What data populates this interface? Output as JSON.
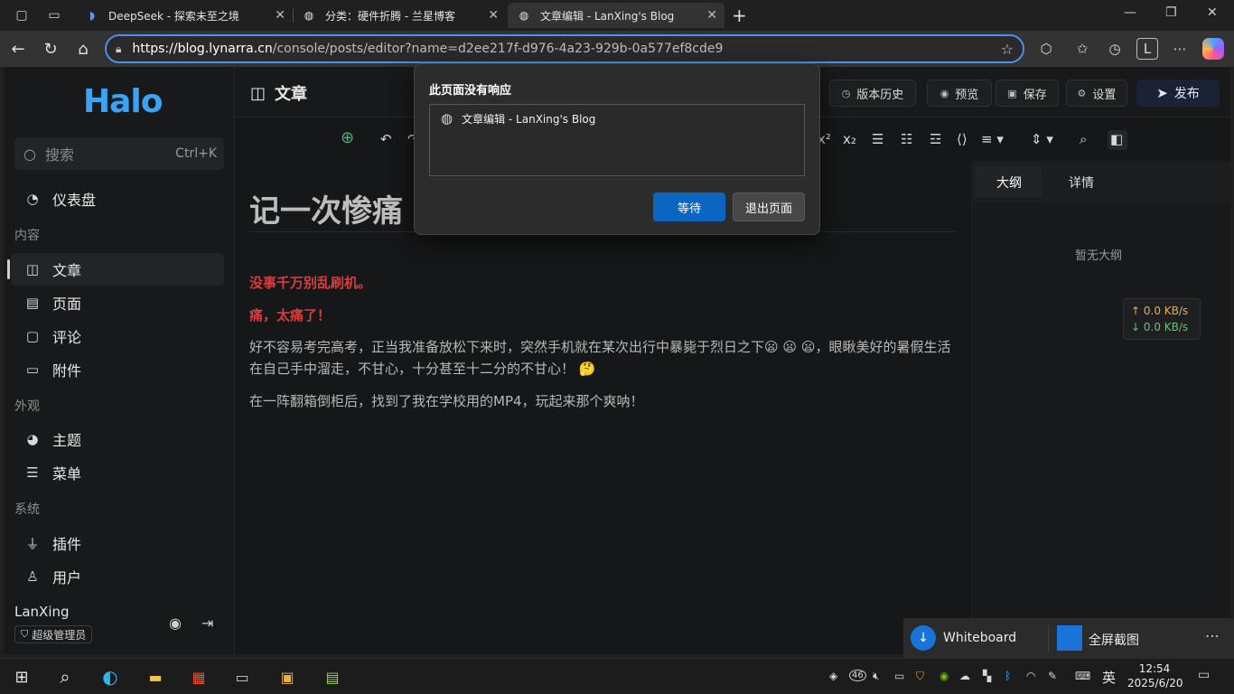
{
  "browser": {
    "tabs": [
      {
        "title": "DeepSeek - 探索未至之境"
      },
      {
        "title": "分类：硬件折腾 - 兰星博客"
      },
      {
        "title": "文章编辑 - LanXing's Blog"
      }
    ],
    "url_host": "https://blog.lynarra.cn",
    "url_path": "/console/posts/editor?name=d2ee217f-d976-4a23-929b-0a577ef8cde9"
  },
  "sidebar": {
    "logo": "Halo",
    "search_label": "搜索",
    "search_shortcut": "Ctrl+K",
    "dashboard": "仪表盘",
    "section_content": "内容",
    "items_content": [
      "文章",
      "页面",
      "评论",
      "附件"
    ],
    "section_appearance": "外观",
    "items_appearance": [
      "主题",
      "菜单"
    ],
    "section_system": "系统",
    "items_system": [
      "插件",
      "用户"
    ],
    "user_name": "LanXing",
    "user_role": "超级管理员"
  },
  "topbar": {
    "title": "文章",
    "history": "版本历史",
    "preview": "预览",
    "save": "保存",
    "settings": "设置",
    "publish": "发布"
  },
  "outline": {
    "tab_outline": "大纲",
    "tab_detail": "详情",
    "empty": "暂无大纲"
  },
  "content": {
    "title": "记一次惨痛",
    "line1": "没事千万别乱刷机。",
    "line2": "痛，太痛了！",
    "para1": "好不容易考完高考，正当我准备放松下来时，突然手机就在某次出行中暴毙于烈日之下😦 😦 😦，眼瞅美好的暑假生活在自己手中溜走，不甘心，十分甚至十二分的不甘心！ 🤔",
    "para2": "在一阵翻箱倒柜后，找到了我在学校用的MP4，玩起来那个爽呐！"
  },
  "netspeed": {
    "up": "↑ 0.0 KB/s",
    "down": "↓ 0.0 KB/s"
  },
  "dialog": {
    "title": "此页面没有响应",
    "page_item": "文章编辑 - LanXing's Blog",
    "wait": "等待",
    "exit": "退出页面"
  },
  "snip_popup": {
    "whiteboard": "Whiteboard",
    "fullscreen": "全屏截图"
  },
  "taskbar": {
    "ime": "英",
    "time": "12:54",
    "date": "2025/6/20",
    "badge": "46"
  }
}
